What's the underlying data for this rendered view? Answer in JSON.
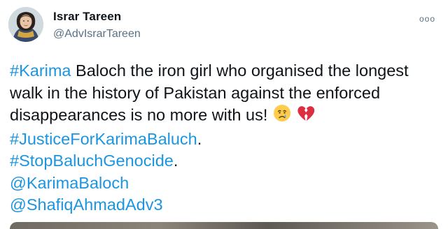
{
  "user": {
    "display_name": "Israr Tareen",
    "handle": "@AdvIsrarTareen"
  },
  "more_menu": "ooo",
  "tweet": {
    "hashtag_karima": "#Karima",
    "text_1": " Baloch the iron girl who organised the longest",
    "text_2": "walk in the history of Pakistan against the enforced",
    "text_3": "disappearances is no more with us!",
    "hashtag_justice": "#JusticeForKarimaBaluch",
    "period_1": ".",
    "hashtag_stop": "#StopBaluchGenocide",
    "period_2": ".",
    "mention_1": "@KarimaBaloch",
    "mention_2": "@ShafiqAhmadAdv3",
    "emojis": [
      "crying-face-icon",
      "broken-heart-icon"
    ]
  },
  "colors": {
    "link": "#1b95e0",
    "text": "#0f1419",
    "secondary": "#5b7083"
  }
}
